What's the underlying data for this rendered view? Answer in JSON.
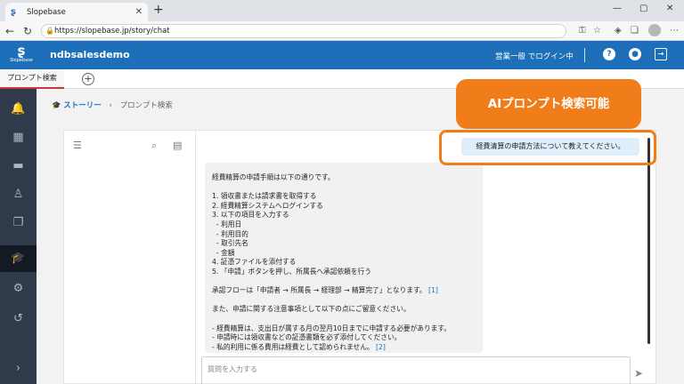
{
  "browser": {
    "tab_title": "Slopebase",
    "url": "https://slopebase.jp/story/chat"
  },
  "app": {
    "logo_text": "Slopebase",
    "name": "ndbsalesdemo",
    "login_status": "営業一般 でログイン中",
    "accent": "#1c6fb8"
  },
  "tabs": {
    "prompt_search": "プロンプト検索"
  },
  "breadcrumb": {
    "story": "ストーリー",
    "separator": "›",
    "current": "プロンプト検索"
  },
  "chat": {
    "user_message": "経費清算の申請方法について教えてください。",
    "bot_lines": [
      "経費精算の申請手順は以下の通りです。",
      "",
      "1. 領収書または請求書を取得する",
      "2. 経費精算システムへログインする",
      "3. 以下の項目を入力する",
      "  - 利用日",
      "  - 利用目的",
      "  - 取引先名",
      "  - 金額",
      "4. 証憑ファイルを添付する",
      "5. 「申請」ボタンを押し、所属長へ承認依頼を行う",
      "",
      "承認フローは「申請者 → 所属長 → 経理部 → 精算完了」となります。",
      "",
      "また、申請に関する注意事項として以下の点にご留意ください。",
      "",
      "- 経費精算は、支出日が属する月の翌月10日までに申請する必要があります。",
      "- 申請時には領収書などの証憑書類を必ず添付してください。",
      "- 私的利用に係る費用は経費として認められません。"
    ],
    "ref1": "[1]",
    "ref2": "[2]",
    "input_placeholder": "質問を入力する"
  },
  "callout": {
    "text": "AIプロンプト検索可能",
    "color": "#f07d1a"
  }
}
